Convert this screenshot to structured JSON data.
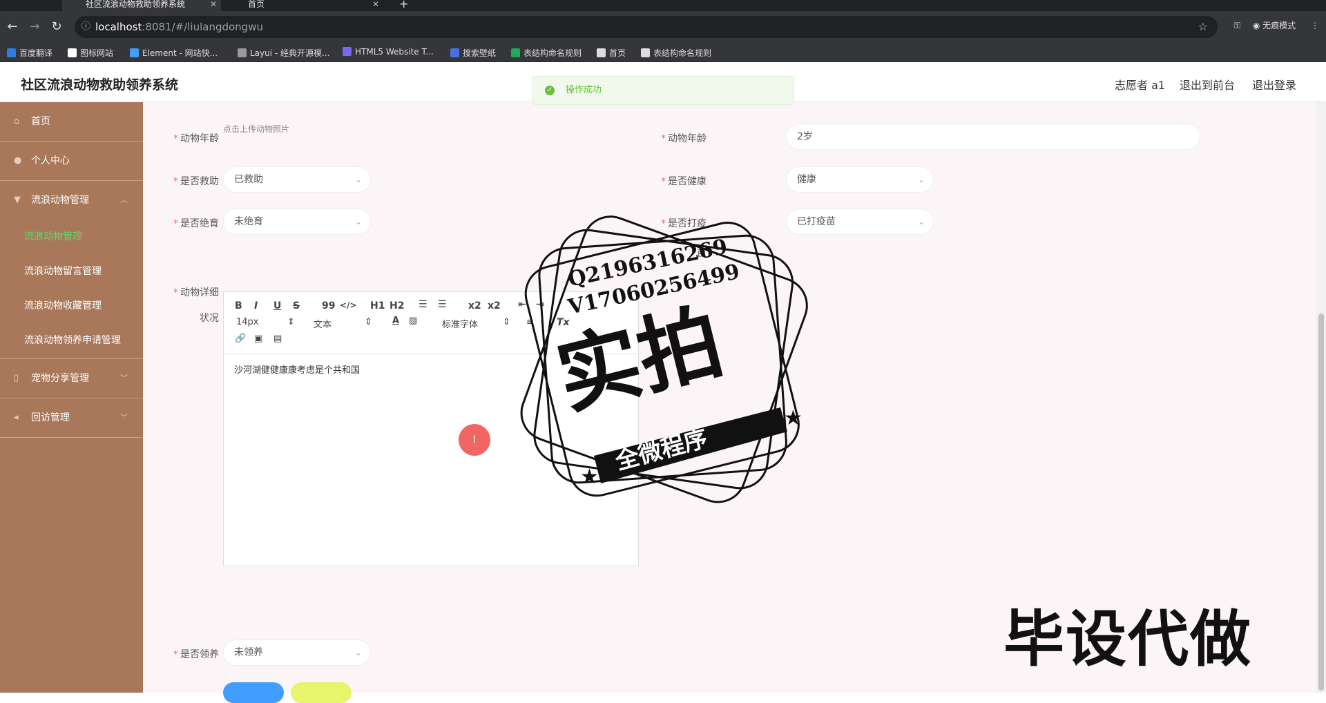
{
  "browser": {
    "tabs": [
      {
        "title": "社区流浪动物救助领养系统"
      },
      {
        "title": "首页"
      }
    ],
    "url_host": "localhost",
    "url_rest": ":8081/#/liulangdongwu",
    "incognito_label": "无痕模式",
    "bookmarks": [
      {
        "label": "百度翻译",
        "color": "#2f7de1"
      },
      {
        "label": "图标网站",
        "color": "#ffffff"
      },
      {
        "label": "Element - 网站快...",
        "color": "#409eff"
      },
      {
        "label": "Layui - 经典开源模...",
        "color": "#999999"
      },
      {
        "label": "HTML5 Website T...",
        "color": "#7b68ee"
      },
      {
        "label": "搜索壁纸",
        "color": "#4a6fe3"
      },
      {
        "label": "表结构命名规则",
        "color": "#22a85a"
      },
      {
        "label": "首页",
        "color": "#dddddd"
      },
      {
        "label": "表结构命名规则",
        "color": "#dddddd"
      }
    ]
  },
  "header": {
    "title": "社区流浪动物救助领养系统",
    "user": "志愿者 a1",
    "to_front": "退出到前台",
    "logout": "退出登录"
  },
  "toast": {
    "message": "操作成功"
  },
  "sidebar": {
    "items": [
      {
        "label": "首页"
      },
      {
        "label": "个人中心"
      },
      {
        "label": "流浪动物管理"
      },
      {
        "label": "宠物分享管理"
      },
      {
        "label": "回访管理"
      }
    ],
    "subitems": [
      {
        "label": "流浪动物管理"
      },
      {
        "label": "流浪动物留言管理"
      },
      {
        "label": "流浪动物收藏管理"
      },
      {
        "label": "流浪动物领养申请管理"
      }
    ]
  },
  "form": {
    "photo_hint": "点击上传动物照片",
    "age_label": "动物年龄",
    "age_value": "2岁",
    "rescued_label": "是否救助",
    "rescued_value": "已救助",
    "healthy_label": "是否健康",
    "healthy_value": "健康",
    "neutered_label": "是否绝育",
    "neutered_value": "未绝育",
    "vaccine_label": "是否打疫",
    "vaccine_label_2": "苗",
    "vaccine_value": "已打疫苗",
    "detail_label": "动物详细",
    "detail_label_2": "状况",
    "adopted_label": "是否领养",
    "adopted_value": "未领养"
  },
  "editor": {
    "font_size": "14px",
    "text_type": "文本",
    "font_family": "标准字体",
    "content": "沙河湖健健康康考虑是个共和国",
    "toolbar": {
      "bold": "B",
      "italic": "I",
      "underline": "U",
      "strike": "S",
      "quote": "99",
      "code": "</>",
      "h1": "H1",
      "h2": "H2",
      "sub": "x2",
      "sup": "x2",
      "clear": "Tx"
    }
  },
  "watermark": {
    "qq": "Q2196316269",
    "vx": "V17060256499",
    "big": "实拍",
    "ribbon": "全微程序",
    "bottom": "毕设代做"
  },
  "colors": {
    "sidebar": "#a9775a",
    "active_menu": "#62d86a",
    "required": "#f56c6c",
    "success": "#67c23a",
    "primary_btn": "#409eff",
    "secondary_btn": "#e6f56b"
  }
}
